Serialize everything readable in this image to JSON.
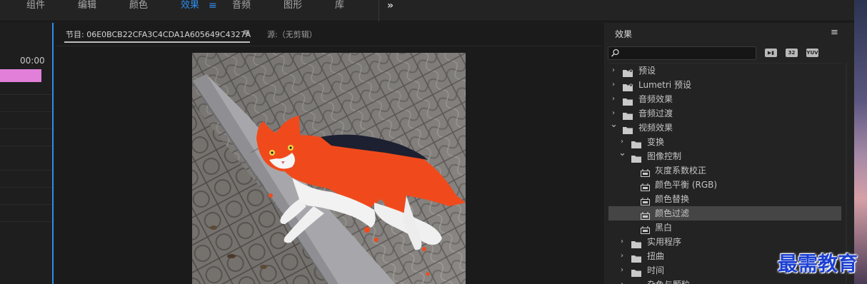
{
  "workspace_tabs": [
    {
      "label": "组件",
      "active": false
    },
    {
      "label": "编辑",
      "active": false
    },
    {
      "label": "颜色",
      "active": false
    },
    {
      "label": "效果",
      "active": true
    },
    {
      "label": "音频",
      "active": false
    },
    {
      "label": "图形",
      "active": false
    },
    {
      "label": "库",
      "active": false
    }
  ],
  "workspace_menu_icon": "hamburger-icon",
  "overflow_icon": "double-chevron-right-icon",
  "timeline": {
    "time": "00:00",
    "clip_color": "#e27fd9"
  },
  "monitor": {
    "program_tab": "节目: 06E0BCB22CFA3C4CDA1A605649C4327A",
    "source_tab": "源:（无剪辑）",
    "menu_icon": "hamburger-icon"
  },
  "effects_panel": {
    "title": "效果",
    "search_placeholder": "",
    "filters": [
      "加速",
      "32",
      "YUV"
    ],
    "tree": [
      {
        "label": "预设",
        "type": "star-folder",
        "depth": 0,
        "expanded": false
      },
      {
        "label": "Lumetri 预设",
        "type": "star-folder",
        "depth": 0,
        "expanded": false
      },
      {
        "label": "音频效果",
        "type": "folder",
        "depth": 0,
        "expanded": false
      },
      {
        "label": "音频过渡",
        "type": "folder",
        "depth": 0,
        "expanded": false
      },
      {
        "label": "视频效果",
        "type": "folder",
        "depth": 0,
        "expanded": true
      },
      {
        "label": "变换",
        "type": "folder",
        "depth": 1,
        "expanded": false
      },
      {
        "label": "图像控制",
        "type": "folder",
        "depth": 1,
        "expanded": true
      },
      {
        "label": "灰度系数校正",
        "type": "effect",
        "depth": 2
      },
      {
        "label": "颜色平衡 (RGB)",
        "type": "effect",
        "depth": 2
      },
      {
        "label": "颜色替换",
        "type": "effect",
        "depth": 2
      },
      {
        "label": "颜色过滤",
        "type": "effect",
        "depth": 2,
        "selected": true
      },
      {
        "label": "黑白",
        "type": "effect",
        "depth": 2
      },
      {
        "label": "实用程序",
        "type": "folder",
        "depth": 1,
        "expanded": false
      },
      {
        "label": "扭曲",
        "type": "folder",
        "depth": 1,
        "expanded": false
      },
      {
        "label": "时间",
        "type": "folder",
        "depth": 1,
        "expanded": false
      },
      {
        "label": "杂色与颗粒",
        "type": "folder",
        "depth": 1,
        "expanded": false
      }
    ]
  },
  "watermark": "最需教育",
  "colors": {
    "accent": "#2d8ceb",
    "selected_row": "#454545",
    "cat_orange": "#f04a1c"
  }
}
